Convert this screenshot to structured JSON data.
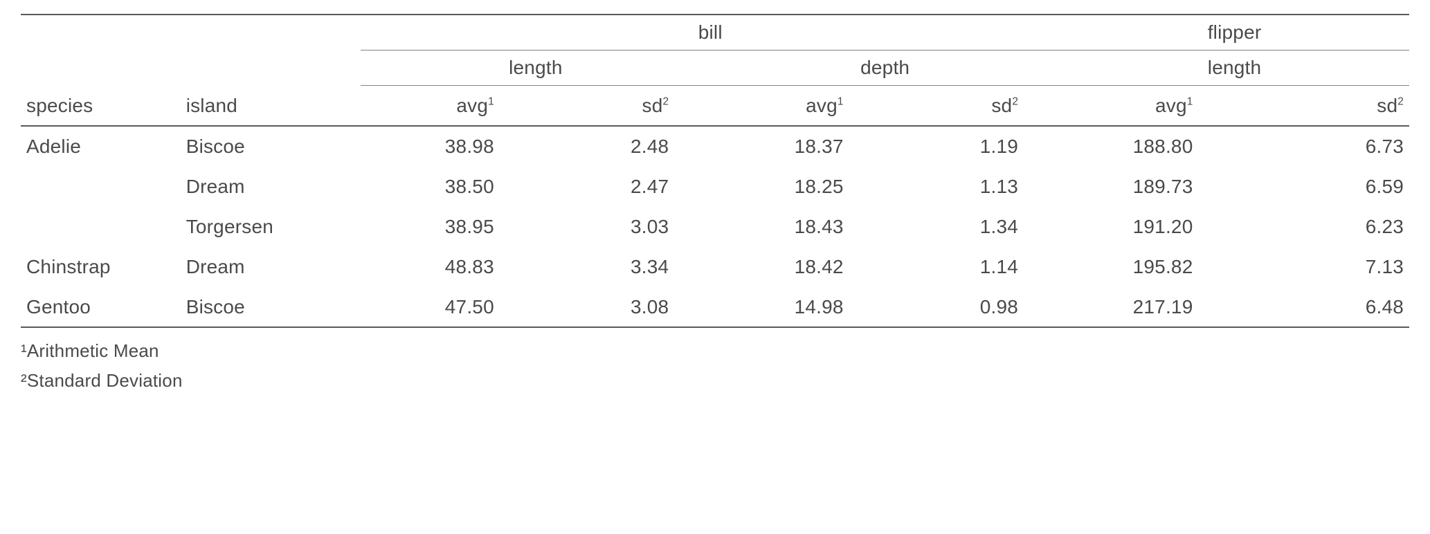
{
  "chart_data": {
    "type": "table",
    "stub_headers": [
      "species",
      "island"
    ],
    "spanners": {
      "bill": {
        "length": [
          "avg",
          "sd"
        ],
        "depth": [
          "avg",
          "sd"
        ]
      },
      "flipper": {
        "length": [
          "avg",
          "sd"
        ]
      }
    },
    "footnotes": {
      "1": "Arithmetic Mean",
      "2": "Standard Deviation"
    },
    "rows": [
      {
        "species": "Adelie",
        "island": "Biscoe",
        "bill_length_avg": 38.98,
        "bill_length_sd": 2.48,
        "bill_depth_avg": 18.37,
        "bill_depth_sd": 1.19,
        "flipper_length_avg": 188.8,
        "flipper_length_sd": 6.73
      },
      {
        "species": "Adelie",
        "island": "Dream",
        "bill_length_avg": 38.5,
        "bill_length_sd": 2.47,
        "bill_depth_avg": 18.25,
        "bill_depth_sd": 1.13,
        "flipper_length_avg": 189.73,
        "flipper_length_sd": 6.59
      },
      {
        "species": "Adelie",
        "island": "Torgersen",
        "bill_length_avg": 38.95,
        "bill_length_sd": 3.03,
        "bill_depth_avg": 18.43,
        "bill_depth_sd": 1.34,
        "flipper_length_avg": 191.2,
        "flipper_length_sd": 6.23
      },
      {
        "species": "Chinstrap",
        "island": "Dream",
        "bill_length_avg": 48.83,
        "bill_length_sd": 3.34,
        "bill_depth_avg": 18.42,
        "bill_depth_sd": 1.14,
        "flipper_length_avg": 195.82,
        "flipper_length_sd": 7.13
      },
      {
        "species": "Gentoo",
        "island": "Biscoe",
        "bill_length_avg": 47.5,
        "bill_length_sd": 3.08,
        "bill_depth_avg": 14.98,
        "bill_depth_sd": 0.98,
        "flipper_length_avg": 217.19,
        "flipper_length_sd": 6.48
      }
    ]
  },
  "headers": {
    "species": "species",
    "island": "island",
    "bill": "bill",
    "flipper": "flipper",
    "length": "length",
    "depth": "depth",
    "avg": "avg",
    "sd": "sd",
    "sup1": "1",
    "sup2": "2"
  },
  "rows": {
    "r0": {
      "species": "Adelie",
      "island": "Biscoe",
      "c0": "38.98",
      "c1": "2.48",
      "c2": "18.37",
      "c3": "1.19",
      "c4": "188.80",
      "c5": "6.73"
    },
    "r1": {
      "species": "",
      "island": "Dream",
      "c0": "38.50",
      "c1": "2.47",
      "c2": "18.25",
      "c3": "1.13",
      "c4": "189.73",
      "c5": "6.59"
    },
    "r2": {
      "species": "",
      "island": "Torgersen",
      "c0": "38.95",
      "c1": "3.03",
      "c2": "18.43",
      "c3": "1.34",
      "c4": "191.20",
      "c5": "6.23"
    },
    "r3": {
      "species": "Chinstrap",
      "island": "Dream",
      "c0": "48.83",
      "c1": "3.34",
      "c2": "18.42",
      "c3": "1.14",
      "c4": "195.82",
      "c5": "7.13"
    },
    "r4": {
      "species": "Gentoo",
      "island": "Biscoe",
      "c0": "47.50",
      "c1": "3.08",
      "c2": "14.98",
      "c3": "0.98",
      "c4": "217.19",
      "c5": "6.48"
    }
  },
  "footnotes": {
    "f1": "¹Arithmetic Mean",
    "f2": "²Standard Deviation"
  }
}
